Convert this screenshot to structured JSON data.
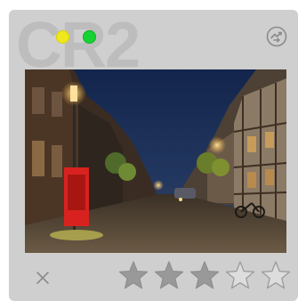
{
  "badge": {
    "text": "CR2"
  },
  "status": {
    "colors": {
      "yellow": "#f0e81c",
      "green": "#17d332"
    }
  },
  "toolbar": {
    "settings_icon": "swap-settings-icon",
    "reject_icon": "close-icon"
  },
  "photo": {
    "subject": "street-at-dusk"
  },
  "rating": {
    "value": 3,
    "max": 5,
    "filled_color": "#999999",
    "empty_color": "#dddddd"
  }
}
